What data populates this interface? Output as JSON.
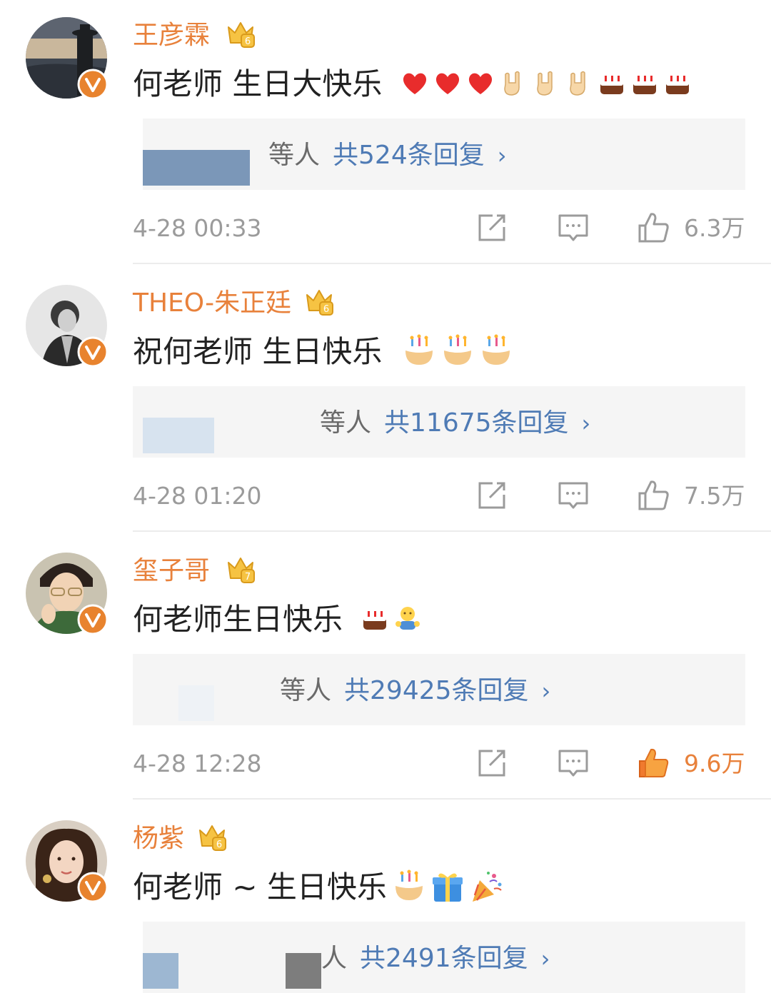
{
  "comments": [
    {
      "username": "王彦霖",
      "text": "何老师 生日大快乐",
      "reply_people": "等人",
      "reply_count": "共524条回复",
      "chevron": "›",
      "time": "4-28 00:33",
      "likes": "6.3万",
      "liked": false,
      "badge_level": "6",
      "emojis": [
        "heart-emoji",
        "heart-emoji",
        "heart-emoji",
        "rock-hand-emoji",
        "rock-hand-emoji",
        "rock-hand-emoji",
        "cake-emoji",
        "cake-emoji",
        "cake-emoji"
      ]
    },
    {
      "username": "THEO-朱正廷",
      "text": "祝何老师 生日快乐",
      "reply_people": "等人",
      "reply_count": "共11675条回复",
      "chevron": "›",
      "time": "4-28 01:20",
      "likes": "7.5万",
      "liked": false,
      "badge_level": "6",
      "emojis": [
        "birthday-cake-emoji",
        "birthday-cake-emoji",
        "birthday-cake-emoji"
      ]
    },
    {
      "username": "玺子哥",
      "text": "何老师生日快乐",
      "reply_people": "等人",
      "reply_count": "共29425条回复",
      "chevron": "›",
      "time": "4-28 12:28",
      "likes": "9.6万",
      "liked": true,
      "badge_level": "7",
      "emojis": [
        "cake-emoji",
        "hug-emoji"
      ]
    },
    {
      "username": "杨紫",
      "text": "何老师 ~ 生日快乐",
      "reply_people": "人",
      "reply_count": "共2491条回复",
      "chevron": "›",
      "time": "",
      "likes": "",
      "liked": false,
      "badge_level": "6",
      "emojis": [
        "birthday-cake-emoji",
        "gift-emoji",
        "party-popper-emoji"
      ]
    }
  ],
  "colors": {
    "username": "#e8813b",
    "text": "#222222",
    "reply_link": "#4f7bb5",
    "meta": "#9b9b9b",
    "liked": "#e8813b",
    "badge": "#e8832e"
  }
}
